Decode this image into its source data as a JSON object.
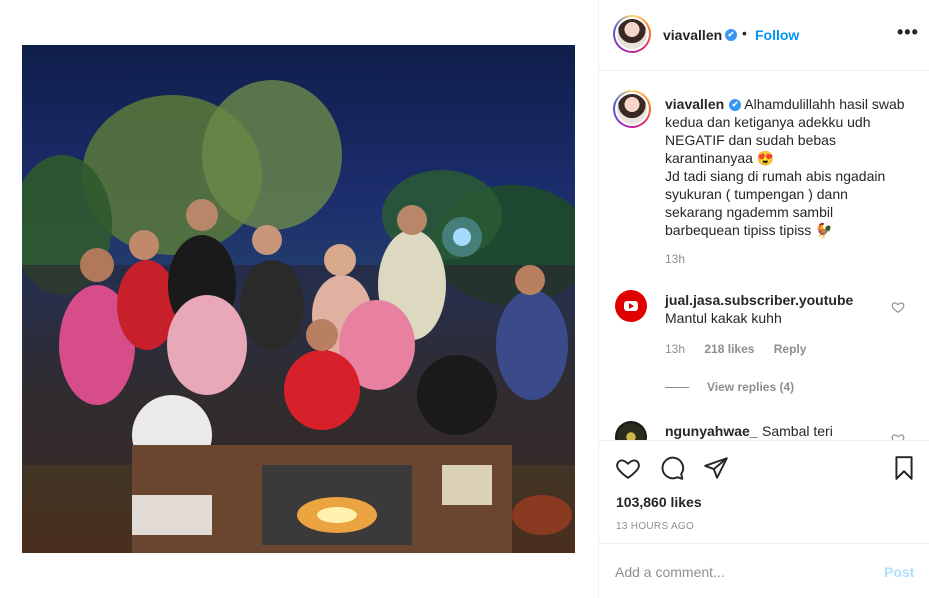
{
  "post": {
    "username": "viavallen",
    "verified_badge": "✔",
    "separator": "•",
    "follow_label": "Follow",
    "more_label": "•••"
  },
  "caption": {
    "username": "viavallen",
    "text": "Alhamdulillahh hasil swab kedua dan ketiganya adekku udh NEGATIF dan sudah bebas karantinanyaa 😍\nJd tadi siang di rumah abis ngadain syukuran ( tumpengan ) dann sekarang ngademm sambil barbequean tipiss tipiss 🐓",
    "time": "13h"
  },
  "comments": [
    {
      "username": "jual.jasa.subscriber.youtube",
      "text": "Mantul kakak kuhh",
      "time": "13h",
      "likes": "218 likes",
      "reply_label": "Reply",
      "view_replies": "View replies (4)"
    },
    {
      "username": "ngunyahwae_",
      "text": "Sambal teri"
    }
  ],
  "actions": {
    "like_icon": "heart-icon",
    "comment_icon": "comment-icon",
    "share_icon": "paper-plane-icon",
    "save_icon": "bookmark-icon"
  },
  "likes_count": "103,860 likes",
  "post_time": "13 HOURS AGO",
  "add_comment": {
    "placeholder": "Add a comment...",
    "post_label": "Post"
  },
  "colors": {
    "link_blue": "#0095f6",
    "verified_blue": "#3897f0",
    "muted": "#8e8e8e",
    "post_disabled": "#b2dffc"
  }
}
